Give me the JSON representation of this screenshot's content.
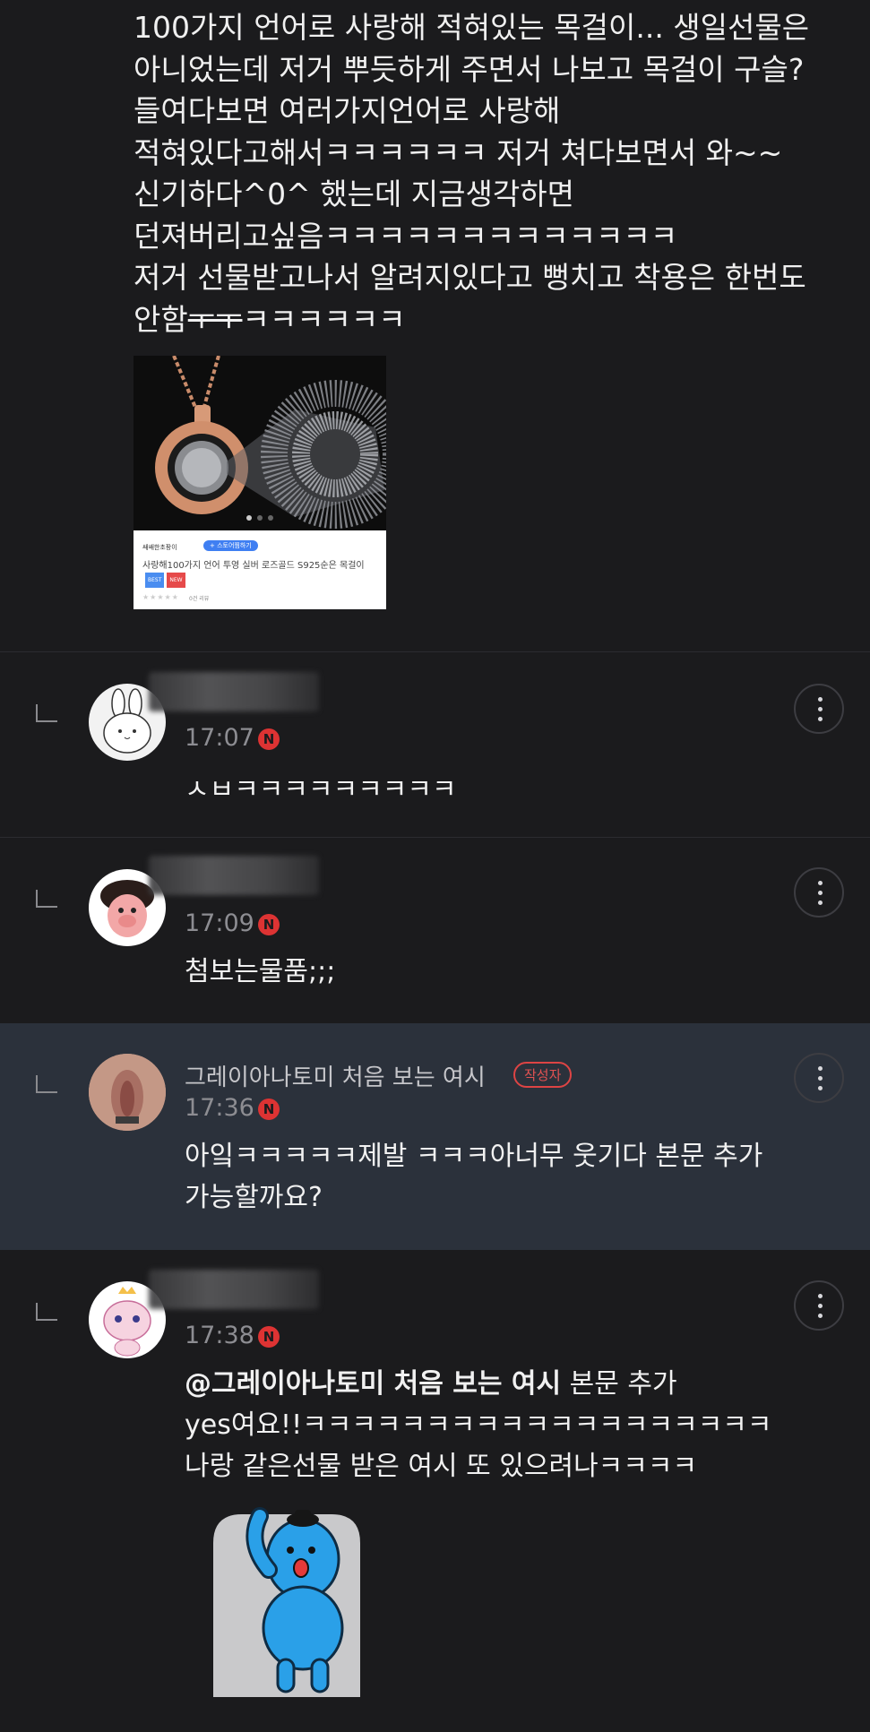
{
  "post": {
    "lines": [
      "100가지 언어로 사랑해 적혀있는 목걸이... 생일선물은",
      "아니었는데 저거 뿌듯하게 주면서 나보고 목걸이 구슬?",
      "들여다보면 여러가지언어로 사랑해",
      "적혀있다고해서ㅋㅋㅋㅋㅋㅋ 저거 쳐다보면서 와~~",
      "신기하다^0^ 했는데 지금생각하면",
      "던져버리고싶음ㅋㅋㅋㅋㅋㅋㅋㅋㅋㅋㅋㅋㅋ",
      "저거 선물받고나서 알려지있다고 뻥치고 착용은 한번도"
    ],
    "last_line_prefix": "안함",
    "last_line_strike": "ㅜㅜ",
    "last_line_suffix": "ㅋㅋㅋㅋㅋㅋ",
    "product": {
      "shop_name": "쌔쌔한초팡이",
      "follow": "+ 스토어찜하기",
      "title": "사랑해100가지 언어 투영 실버 로즈골드 S925순은 목걸이",
      "badge_best": "BEST",
      "badge_new": "NEW",
      "stars": "★★★★★",
      "rating": "0건 리뷰"
    }
  },
  "comments": [
    {
      "time": "17:07",
      "new": "N",
      "text": [
        "ㅅㅂㅋㅋㅋㅋㅋㅋㅋㅋㅋ"
      ]
    },
    {
      "time": "17:09",
      "new": "N",
      "text": [
        "첨보는물품;;;"
      ]
    },
    {
      "author": "그레이아나토미 처음 보는 여시",
      "badge": "작성자",
      "time": "17:36",
      "new": "N",
      "text": [
        "아잌ㅋㅋㅋㅋㅋ제발 ㅋㅋㅋ아너무 웃기다 본문 추가",
        "가능할까요?"
      ]
    },
    {
      "time": "17:38",
      "new": "N",
      "mention": "@그레이아나토미 처음 보는 여시",
      "text": [
        " 본문 추가",
        "yes여요!!ㅋㅋㅋㅋㅋㅋㅋㅋㅋㅋㅋㅋㅋㅋㅋㅋㅋㅋㅋ",
        "나랑 같은선물 받은 여시 또 있으려나ㅋㅋㅋㅋ"
      ]
    }
  ],
  "colors": {
    "background": "#1b1b1d",
    "highlight": "#2b313b",
    "new_dot": "#dd3333",
    "author_badge": "#e25252"
  },
  "icons": [
    "reply-arrow-icon",
    "more-vertical-icon",
    "new-badge-icon"
  ]
}
